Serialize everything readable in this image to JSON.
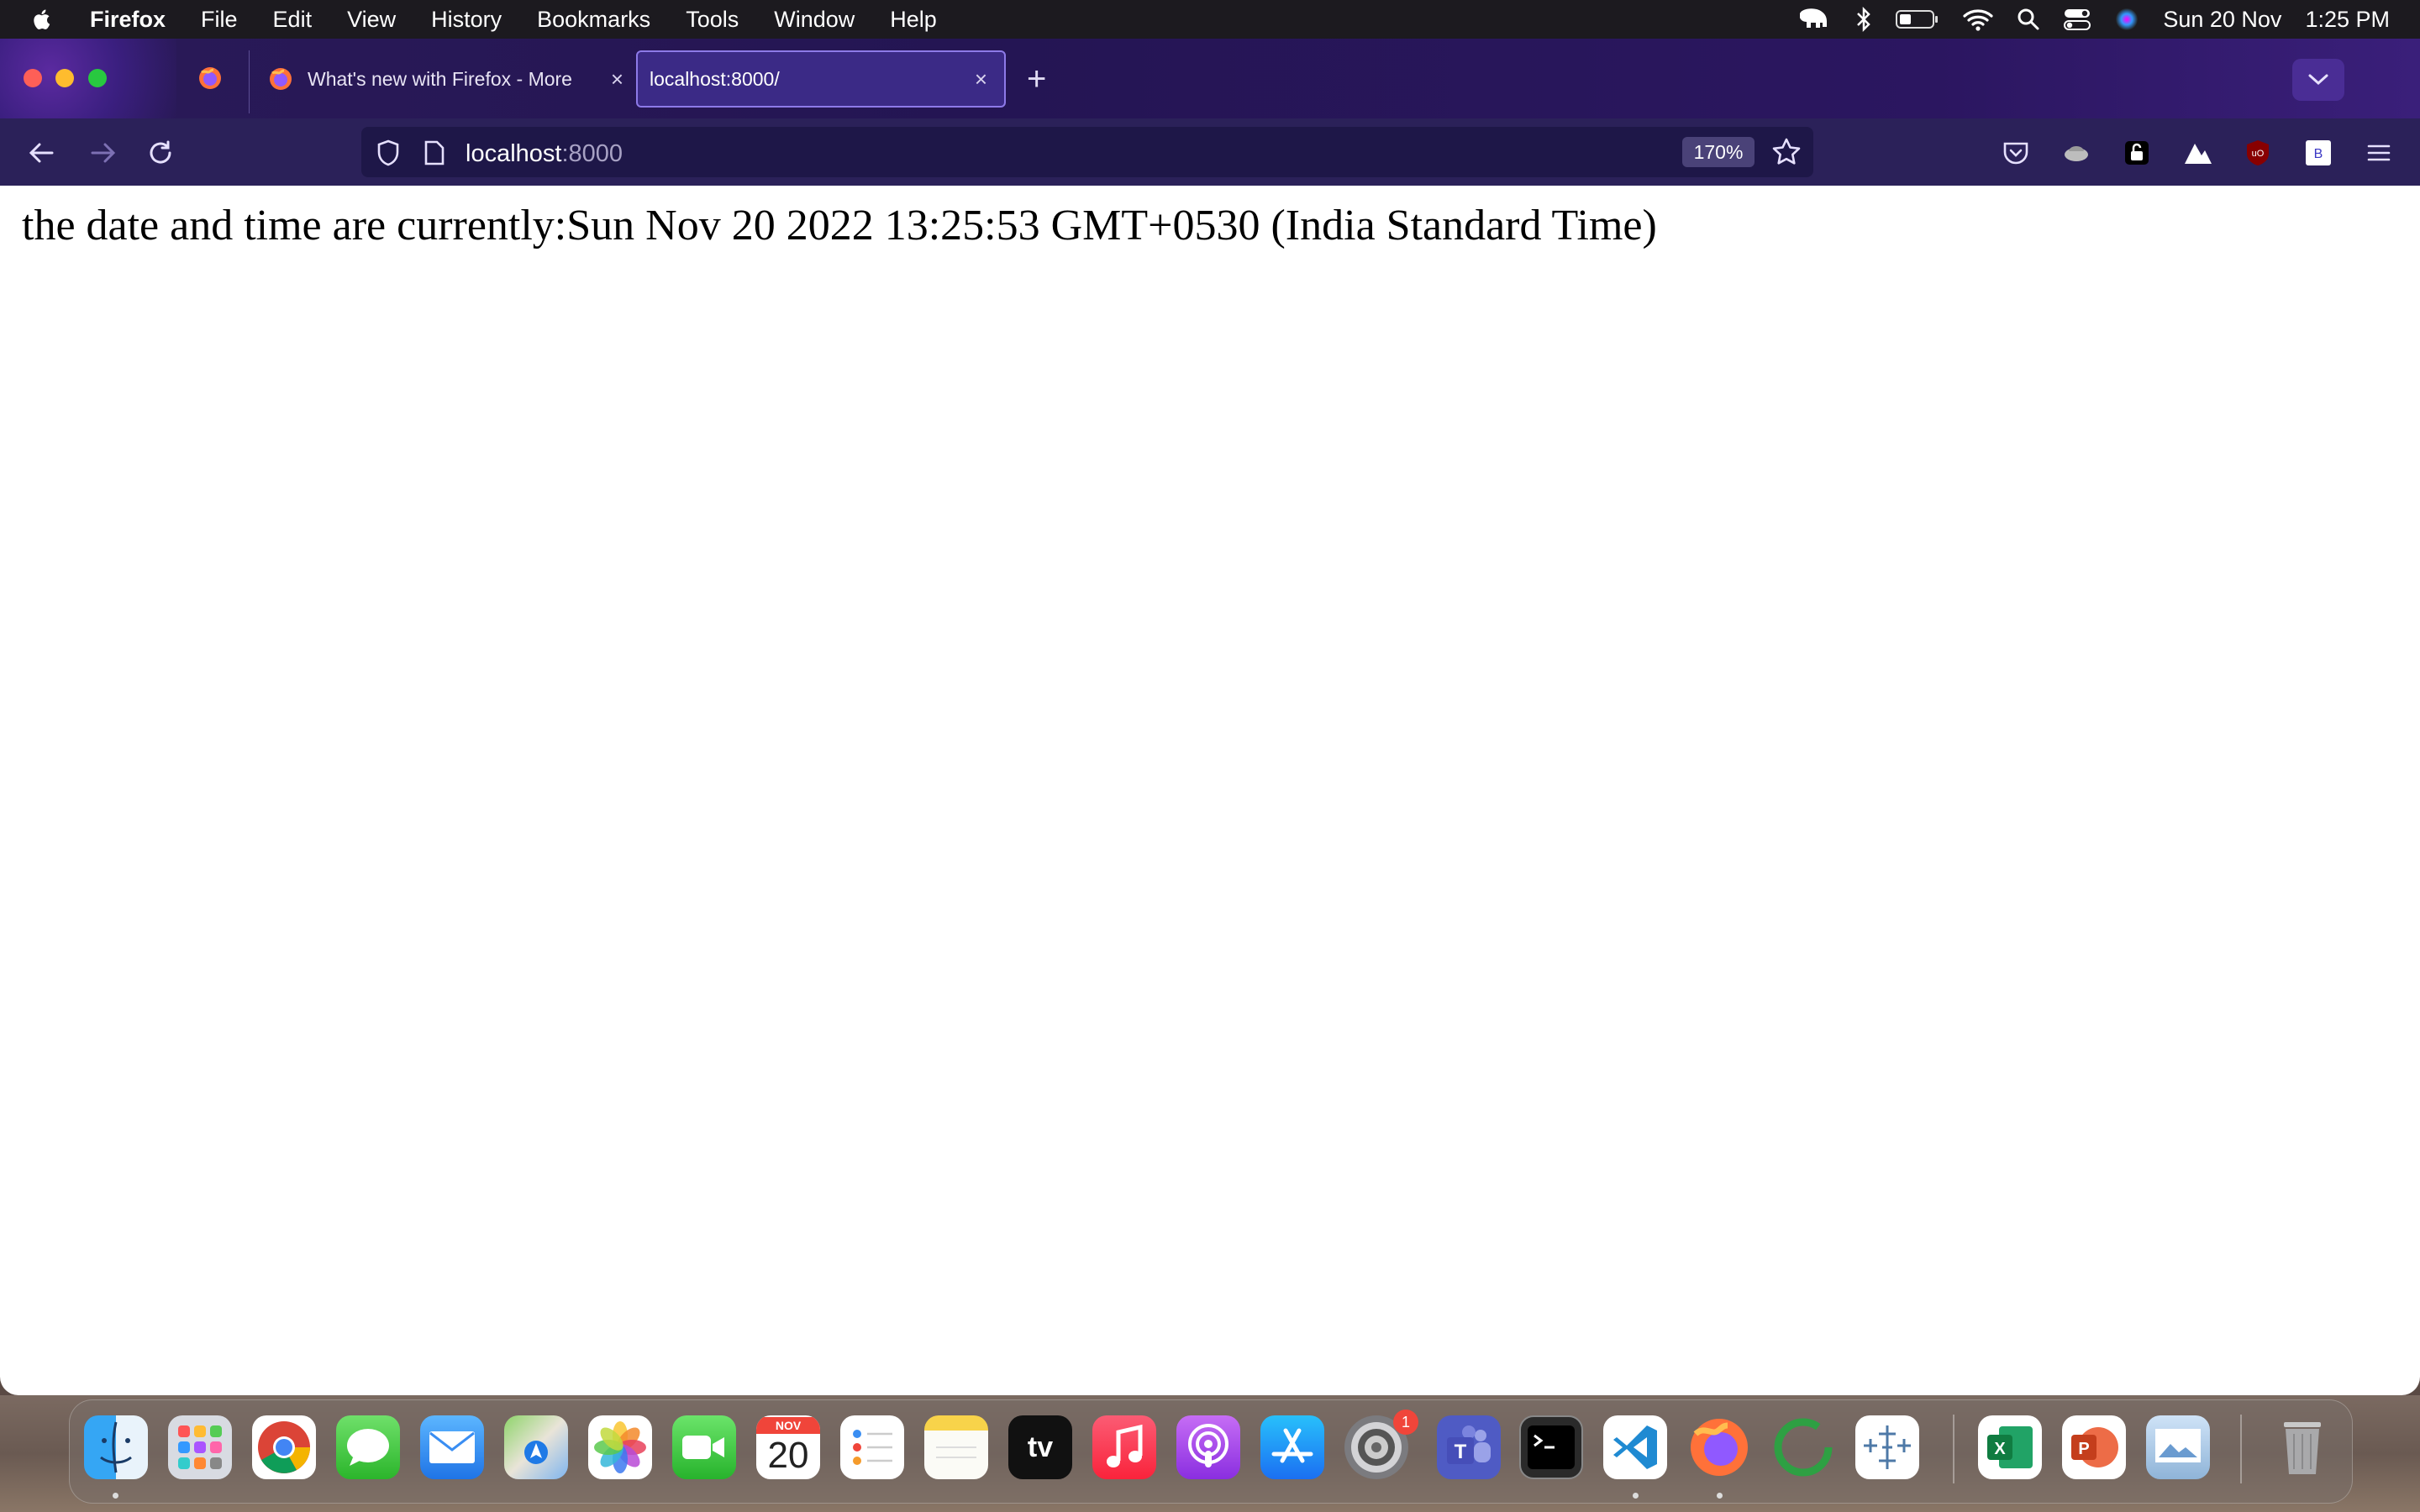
{
  "menubar": {
    "app_name": "Firefox",
    "menus": [
      "File",
      "Edit",
      "View",
      "History",
      "Bookmarks",
      "Tools",
      "Window",
      "Help"
    ],
    "clock_date": "Sun 20 Nov",
    "clock_time": "1:25 PM",
    "status_icons": [
      "elephant-icon",
      "bluetooth-icon",
      "battery-icon",
      "wifi-icon",
      "search-icon",
      "control-center-icon",
      "siri-icon"
    ]
  },
  "tabs": {
    "items": [
      {
        "title": "What's new with Firefox - More",
        "active": false
      },
      {
        "title": "localhost:8000/",
        "active": true
      }
    ],
    "new_tab_symbol": "+",
    "close_symbol": "×"
  },
  "toolbar": {
    "url_host": "localhost",
    "url_port": ":8000",
    "zoom": "170%"
  },
  "page": {
    "text": "the date and time are currently:Sun Nov 20 2022 13:25:53 GMT+0530 (India Standard Time)"
  },
  "dock": {
    "calendar_month": "NOV",
    "calendar_day": "20",
    "settings_badge": "1",
    "tv_label": "tv",
    "apps": [
      "Finder",
      "Launchpad",
      "Chrome",
      "Messages",
      "Mail",
      "Maps",
      "Photos",
      "FaceTime",
      "Calendar",
      "Reminders",
      "Notes",
      "TV",
      "Music",
      "Podcasts",
      "App Store",
      "System Preferences",
      "Teams",
      "Terminal",
      "VS Code",
      "Firefox",
      "Activity",
      "Tableau",
      "Excel",
      "PowerPoint",
      "Preview",
      "Trash"
    ]
  },
  "colors": {
    "menubar_bg": "#1c1a1f",
    "tabstrip_bg": "#241553",
    "toolbar_bg": "#2b2159",
    "accent": "#8d7ae8"
  }
}
